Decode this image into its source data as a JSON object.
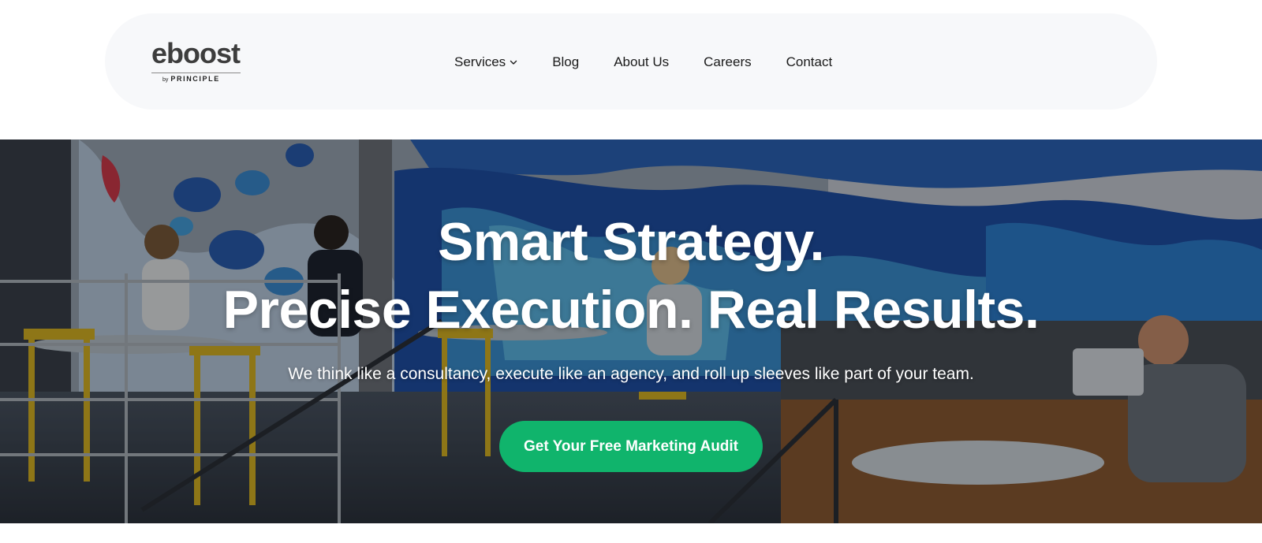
{
  "header": {
    "logo": {
      "word": "eboost",
      "by": "by",
      "brand": "PRINCIPLE"
    },
    "menu": [
      {
        "label": "Services",
        "has_dropdown": true
      },
      {
        "label": "Blog"
      },
      {
        "label": "About Us"
      },
      {
        "label": "Careers"
      },
      {
        "label": "Contact"
      }
    ]
  },
  "hero": {
    "headline_line1": "Smart Strategy.",
    "headline_line2": "Precise Execution. Real Results.",
    "tagline": "We think like a consultancy, execute like an agency, and roll up sleeves like part of your team.",
    "cta_label": "Get Your Free Marketing Audit",
    "background_image": "people working at tables on a patio in front of a blue camouflage mural"
  },
  "colors": {
    "nav_background": "#f7f8fa",
    "cta_green": "#10b46c",
    "text_dark": "#1a1a1a"
  }
}
